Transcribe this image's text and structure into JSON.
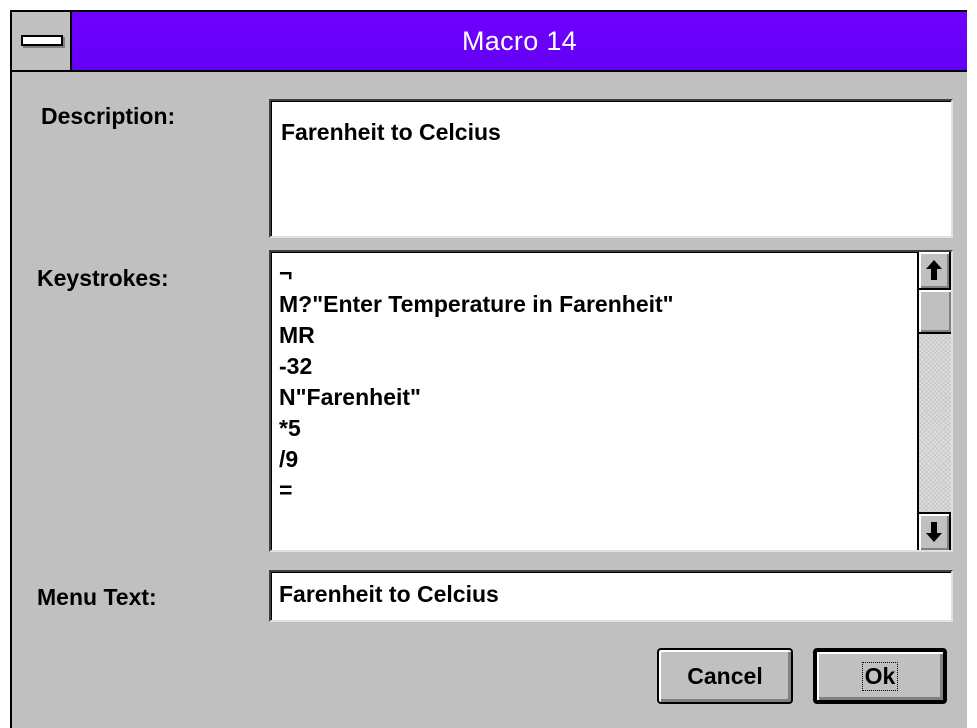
{
  "window": {
    "title": "Macro 14"
  },
  "description": {
    "label": "Description:",
    "value": "Farenheit to Celcius"
  },
  "keystrokes": {
    "label": "Keystrokes:",
    "lines": [
      "¬",
      "M?\"Enter Temperature in Farenheit\"",
      "MR",
      "-32",
      "N\"Farenheit\"",
      "*5",
      "/9",
      "="
    ]
  },
  "menu_text": {
    "label": "Menu Text:",
    "value": "Farenheit to Celcius"
  },
  "buttons": {
    "cancel_label": "Cancel",
    "ok_label": "Ok"
  },
  "icons": {
    "system_menu": "system-menu-icon",
    "scroll_up": "arrow-up-icon",
    "scroll_down": "arrow-down-icon"
  }
}
